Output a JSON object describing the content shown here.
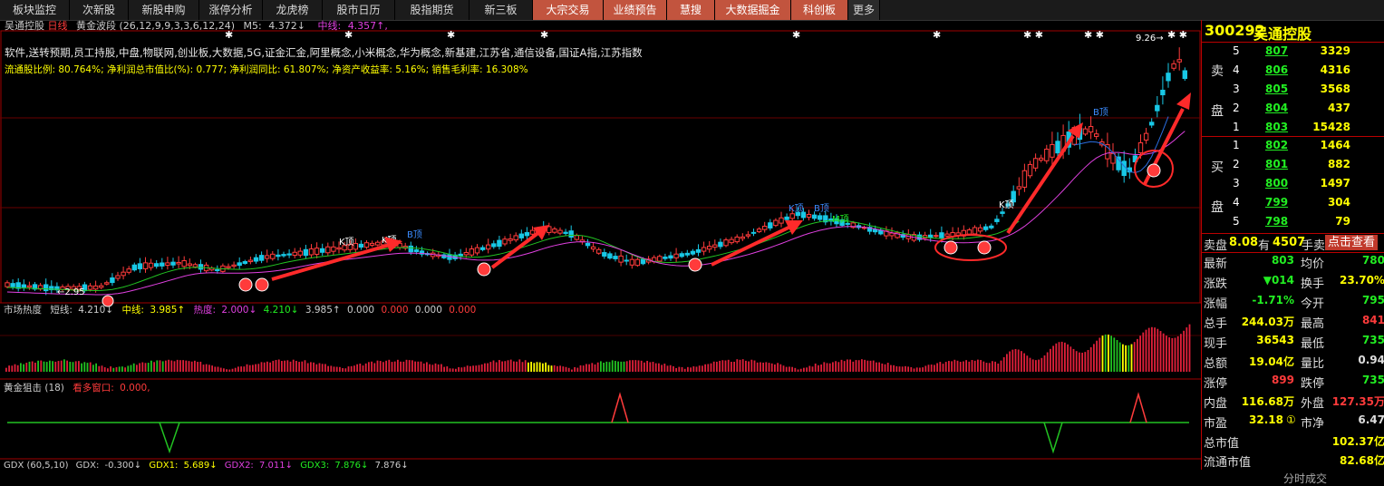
{
  "colors": {
    "up": "#ff3b3b",
    "down": "#18c8e6",
    "ma_short": "#ffffff",
    "ma_mid": "#e040e0",
    "ma_green": "#22c322",
    "price": "#ffff00",
    "red_text": "#ff3b3b",
    "green_text": "#22ee22",
    "highlight": "#ff2a2a"
  },
  "tabs": [
    "板块监控",
    "次新股",
    "新股申购",
    "涨停分析",
    "龙虎榜",
    "股市日历",
    "股指期货",
    "新三板",
    "大宗交易",
    "业绩预告",
    "慧搜",
    "大数据掘金",
    "科创板",
    "更多"
  ],
  "chart_header": {
    "stock_name": "吴通控股",
    "period": "日线",
    "indicator_name": "黄金波段",
    "indicator_params": "(26,12,9,9,3,3,6,12,24)",
    "ma5_label": "M5:",
    "ma5_value": "4.372↓",
    "mid_label": "中线:",
    "mid_value": "4.357↑,"
  },
  "concepts": "软件,送转预期,员工持股,中盘,物联网,创业板,大数据,5G,证金汇金,阿里概念,小米概念,华为概念,新基建,江苏省,通信设备,国证A指,江苏指数",
  "fundamentals": "流通股比例: 80.764%; 净利润总市值比(%): 0.777; 净利润同比: 61.807%; 净资产收益率: 5.16%; 销售毛利率: 16.308%",
  "annotations": {
    "low_price": "←2.95",
    "high_price": "9.26→",
    "k_top": "K顶",
    "b_top": "B顶",
    "m_top": "M顶"
  },
  "panel2": {
    "title": "市场热度",
    "short_label": "短线:",
    "short_value": "4.210↓",
    "mid_label": "中线:",
    "mid_value": "3.985↑",
    "heat_label": "热度:",
    "heat_value": "2.000↓",
    "v1": "4.210↓",
    "v2": "3.985↑",
    "v3": "0.000",
    "v4": "0.000",
    "v5": "0.000",
    "v6": "0.000"
  },
  "panel3": {
    "title": "黄金狙击",
    "param": "(18)",
    "label": "看多窗口:",
    "value": "0.000,"
  },
  "panel4": {
    "title": "GDX",
    "params": "(60,5,10)",
    "gdx_label": "GDX:",
    "gdx_value": "-0.300↓",
    "gdx1_label": "GDX1:",
    "gdx1_value": "5.689↓",
    "gdx2_label": "GDX2:",
    "gdx2_value": "7.011↓",
    "gdx3_label": "GDX3:",
    "gdx3_value": "7.876↓",
    "extra": "7.876↓"
  },
  "quote": {
    "code": "300292",
    "name": "吴通控股",
    "sell_label": [
      "卖",
      "盘"
    ],
    "buy_label": [
      "买",
      "盘"
    ],
    "sell": [
      {
        "level": "5",
        "price": "807",
        "vol": "3329"
      },
      {
        "level": "4",
        "price": "806",
        "vol": "4316"
      },
      {
        "level": "3",
        "price": "805",
        "vol": "3568"
      },
      {
        "level": "2",
        "price": "804",
        "vol": "437"
      },
      {
        "level": "1",
        "price": "803",
        "vol": "15428"
      }
    ],
    "buy": [
      {
        "level": "1",
        "price": "802",
        "vol": "1464"
      },
      {
        "level": "2",
        "price": "801",
        "vol": "882"
      },
      {
        "level": "3",
        "price": "800",
        "vol": "1497"
      },
      {
        "level": "4",
        "price": "799",
        "vol": "304"
      },
      {
        "level": "5",
        "price": "798",
        "vol": "79"
      }
    ],
    "ticker": {
      "prefix": "卖盘",
      "price": "8.08",
      "mid": "有",
      "vol": "4507",
      "unit": "手卖",
      "action": "点击查看"
    },
    "stats": [
      {
        "l1": "最新",
        "v1": "803",
        "l2": "均价",
        "v2": "780"
      },
      {
        "l1": "涨跌",
        "v1": "▼014",
        "l2": "换手",
        "v2": "23.70%"
      },
      {
        "l1": "涨幅",
        "v1": "-1.71%",
        "l2": "今开",
        "v2": "795"
      },
      {
        "l1": "总手",
        "v1": "244.03万",
        "l2": "最高",
        "v2": "841"
      },
      {
        "l1": "现手",
        "v1": "36543",
        "l2": "最低",
        "v2": "735"
      },
      {
        "l1": "总额",
        "v1": "19.04亿",
        "l2": "量比",
        "v2": "0.94"
      },
      {
        "l1": "涨停",
        "v1": "899",
        "l2": "跌停",
        "v2": "735"
      },
      {
        "l1": "内盘",
        "v1": "116.68万",
        "l2": "外盘",
        "v2": "127.35万"
      },
      {
        "l1": "市盈",
        "v1": "32.18",
        "l2": "市净",
        "v2": "6.47"
      }
    ],
    "pe_badge": "①",
    "market_cap_label": "总市值",
    "market_cap": "102.37亿",
    "float_cap_label": "流通市值",
    "float_cap": "82.68亿",
    "bottom_tab": "分时成交"
  }
}
